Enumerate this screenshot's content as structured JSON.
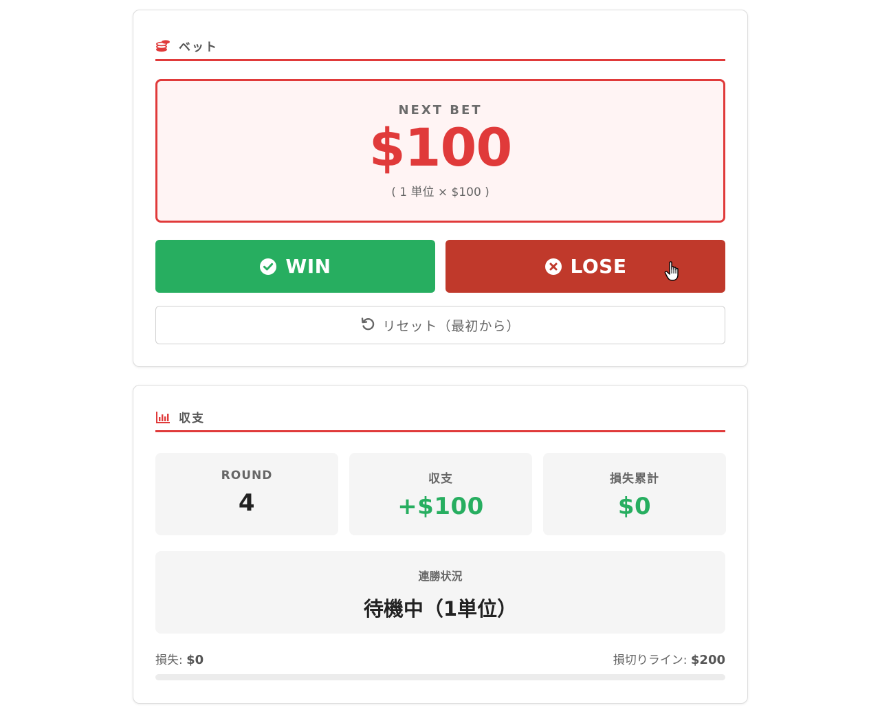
{
  "bet_section": {
    "title": "ベット",
    "next_bet_label": "NEXT BET",
    "next_bet_amount": "$100",
    "next_bet_detail": "( 1 単位 × $100 )",
    "win_label": "WIN",
    "lose_label": "LOSE",
    "reset_label": "リセット（最初から）"
  },
  "stats_section": {
    "title": "収支",
    "round_label": "ROUND",
    "round_value": "4",
    "balance_label": "収支",
    "balance_value": "+$100",
    "cumulative_loss_label": "損失累計",
    "cumulative_loss_value": "$0",
    "streak_label": "連勝状況",
    "streak_value": "待機中（1単位）",
    "loss_label": "損失:",
    "loss_value": "$0",
    "stop_loss_label": "損切りライン:",
    "stop_loss_value": "$200",
    "loss_progress": 0
  },
  "icons": {
    "bet": "coins-icon",
    "stats": "chart-bar-icon",
    "win": "check-circle-icon",
    "lose": "x-circle-icon",
    "reset": "undo-icon",
    "cursor": "pointer-hand-icon"
  },
  "colors": {
    "accent": "#e03a3a",
    "win": "#27ae60",
    "lose": "#c0392b",
    "next_bet_bg": "#fff4f4",
    "stat_bg": "#f5f5f5"
  }
}
